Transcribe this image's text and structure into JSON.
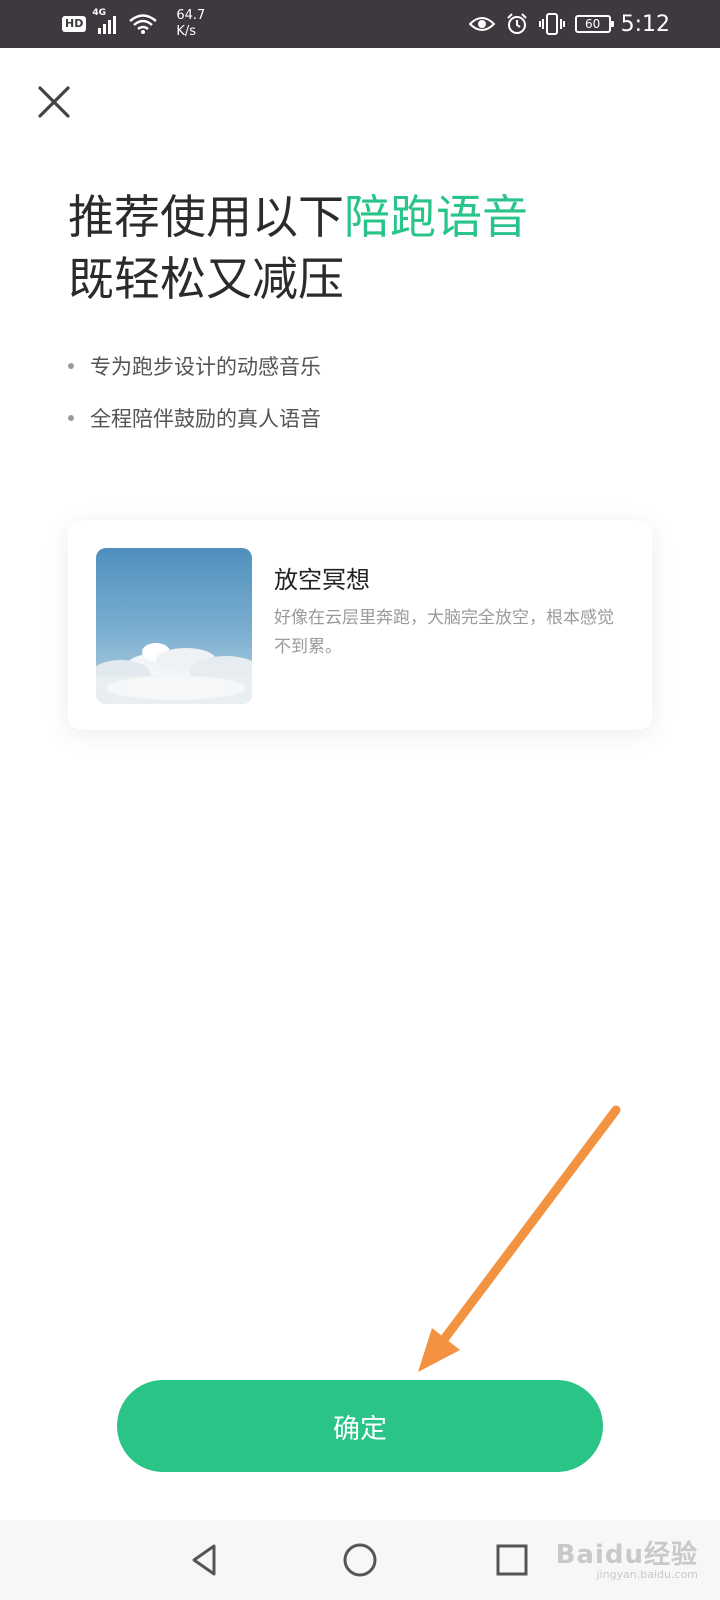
{
  "status_bar": {
    "hd": "HD",
    "network": "4G",
    "speed_value": "64.7",
    "speed_unit": "K/s",
    "battery": "60",
    "time": "5:12"
  },
  "icons": {
    "close": "close-icon",
    "eye": "eye-icon",
    "alarm": "alarm-icon",
    "vibrate": "vibrate-icon",
    "back": "back-triangle-icon",
    "home": "home-circle-icon",
    "recents": "recents-square-icon"
  },
  "headline": {
    "line1_prefix": "推荐使用以下",
    "line1_highlight": "陪跑语音",
    "line2": "既轻松又减压"
  },
  "bullets": [
    "专为跑步设计的动感音乐",
    "全程陪伴鼓励的真人语音"
  ],
  "card": {
    "title": "放空冥想",
    "description": "好像在云层里奔跑，大脑完全放空，根本感觉不到累。"
  },
  "confirm_button": {
    "label": "确定"
  },
  "watermark": {
    "main": "Baidu经验",
    "sub": "jingyan.baidu.com"
  },
  "colors": {
    "accent": "#29c48a",
    "button": "#2ac487",
    "status_bar": "#3f383e",
    "annotation_arrow": "#f39240"
  }
}
